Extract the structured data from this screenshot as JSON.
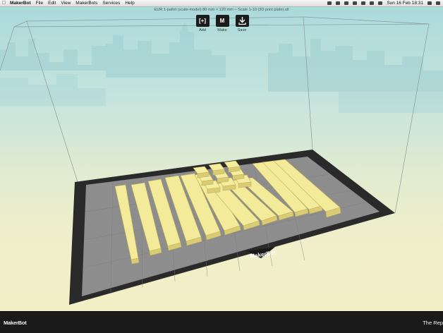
{
  "menubar": {
    "apple": "",
    "items": [
      "MakerBot",
      "File",
      "Edit",
      "View",
      "MakerBots",
      "Services",
      "Help"
    ],
    "datetime": "Sun 16 Feb  18:31"
  },
  "window": {
    "title": "EUR 1-pallet (scale-model) 80 mm × 120 mm – Scale 1-10 (3D print plate).stl"
  },
  "toolbar": {
    "add": {
      "icon": "add-icon",
      "label": "Add"
    },
    "make": {
      "icon": "makerbot-m-icon",
      "label": "Make"
    },
    "save": {
      "icon": "download-icon",
      "label": "Save"
    }
  },
  "plate": {
    "brand": "MakerBot"
  },
  "bottom": {
    "logo": "MakerBot",
    "right_text": "The Rep"
  },
  "colors": {
    "model": "#f3ea9a",
    "plate_border": "#2a2a2a",
    "plate_bed": "#8d8d8d"
  }
}
